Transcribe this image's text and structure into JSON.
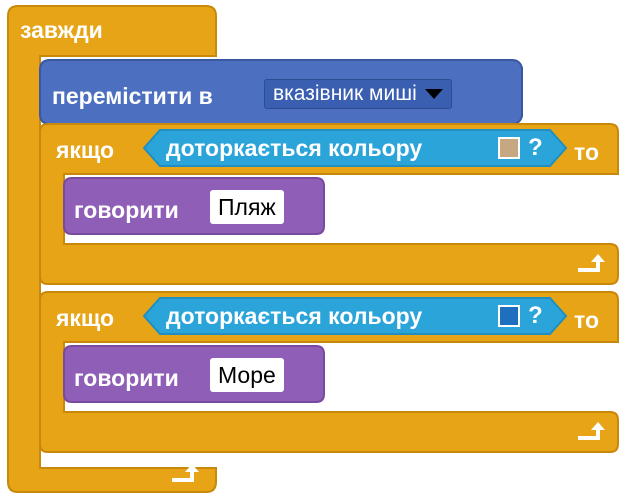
{
  "blocks": {
    "forever": {
      "label": "завжди",
      "color": "#e6a416"
    },
    "move": {
      "label": "перемістити в",
      "dropdown_value": "вказівник миші",
      "color": "#4c6fc0"
    },
    "if_1": {
      "label": "якщо",
      "then_label": "то",
      "sensing_label": "доторкається кольору",
      "question_mark": "?",
      "swatch_color": "#c5a881",
      "say_label": "говорити",
      "say_value": "Пляж"
    },
    "if_2": {
      "label": "якщо",
      "then_label": "то",
      "sensing_label": "доторкається кольору",
      "question_mark": "?",
      "swatch_color": "#1f6fbf",
      "say_label": "говорити",
      "say_value": "Море"
    }
  },
  "colors": {
    "control": "#e6a416",
    "control_border": "#c8890a",
    "motion": "#4c6fc0",
    "sensing": "#2ba5d9",
    "looks": "#8f5fb8"
  },
  "icons": {
    "loop_return": "loop-return-arrow-icon",
    "dropdown": "dropdown-triangle-icon"
  }
}
